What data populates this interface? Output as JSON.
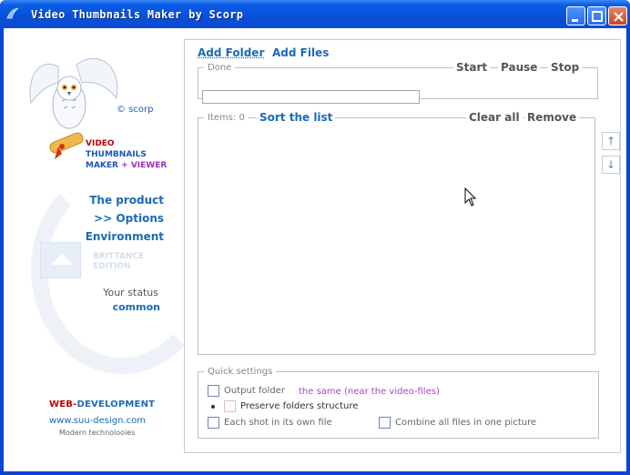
{
  "window": {
    "title": "Video Thumbnails Maker by Scorp"
  },
  "brand": {
    "copyright": "© scorp",
    "line1": "VIDEO",
    "line2": "THUMBNAILS",
    "line3_a": "MAKER",
    "line3_plus": "+",
    "line3_b": "VIEWER"
  },
  "nav": {
    "product": "The product",
    "options": ">> Options",
    "environment": "Environment"
  },
  "edition": {
    "line1": "BRITTANCE",
    "line2": "EDITION"
  },
  "status": {
    "label": "Your status",
    "value": "common"
  },
  "footer": {
    "web": "WEB-",
    "dev": "DEVELOPMENT",
    "site": "www.suu-design.com",
    "tagline": "Modern technoloоies"
  },
  "toolbar": {
    "add_folder": "Add Folder",
    "add_files": "Add Files"
  },
  "progress": {
    "legend": "Done",
    "start": "Start",
    "pause": "Pause",
    "stop": "Stop",
    "fraction": 0
  },
  "items": {
    "legend": "Items: 0",
    "sort": "Sort the list",
    "clear_all": "Clear all",
    "remove": "Remove",
    "up_arrow": "↑",
    "down_arrow": "↓"
  },
  "quick": {
    "legend": "Quick settings",
    "output_folder": "Output  folder",
    "output_hint": "the same (near the video-files)",
    "preserve": "Preserve folders structure",
    "each_shot": "Each shot in its own file",
    "combine": "Combine all files in one picture"
  }
}
